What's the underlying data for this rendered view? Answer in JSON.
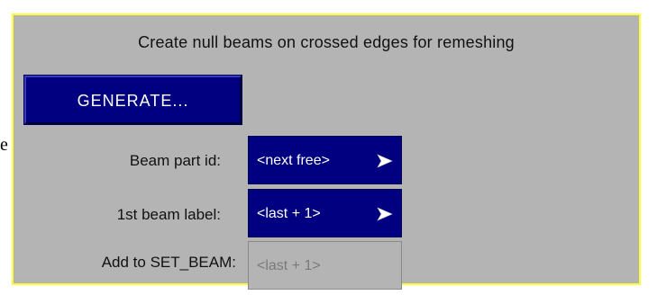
{
  "stray_glyph": "e",
  "panel": {
    "title": "Create null beams on crossed edges for remeshing",
    "generate_button": "GENERATE...",
    "rows": [
      {
        "label": "Beam part id:",
        "value": "<next free>",
        "state": "active",
        "has_arrow": true
      },
      {
        "label": "1st beam label:",
        "value": "<last + 1>",
        "state": "active",
        "has_arrow": true
      },
      {
        "label": "Add to SET_BEAM:",
        "value": "<last + 1>",
        "state": "disabled",
        "has_arrow": false
      }
    ]
  },
  "colors": {
    "panel_bg": "#b4b4b4",
    "panel_border": "#ffff33",
    "button_bg": "#000080",
    "button_text": "#ffffff",
    "disabled_text": "#7a7a7a"
  },
  "icons": {
    "dropdown_arrow": "arrow-right-icon"
  }
}
